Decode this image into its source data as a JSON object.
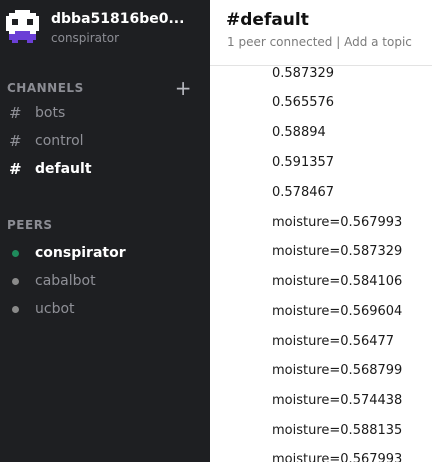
{
  "profile": {
    "name": "dbba51816be0...",
    "subtitle": "conspirator"
  },
  "channels": {
    "heading": "CHANNELS",
    "add_label": "+",
    "items": [
      {
        "label": "bots",
        "active": false
      },
      {
        "label": "control",
        "active": false
      },
      {
        "label": "default",
        "active": true
      }
    ]
  },
  "peers": {
    "heading": "PEERS",
    "items": [
      {
        "label": "conspirator",
        "online": true
      },
      {
        "label": "cabalbot",
        "online": false
      },
      {
        "label": "ucbot",
        "online": false
      }
    ]
  },
  "header": {
    "title": "#default",
    "peers_connected": "1 peer connected",
    "separator": " | ",
    "topic_link": "Add a topic"
  },
  "messages": [
    "0.587329",
    "0.565576",
    "0.58894",
    "0.591357",
    "0.578467",
    "moisture=0.567993",
    "moisture=0.587329",
    "moisture=0.584106",
    "moisture=0.569604",
    "moisture=0.56477",
    "moisture=0.568799",
    "moisture=0.574438",
    "moisture=0.588135",
    "moisture=0.567993"
  ],
  "colors": {
    "sidebar_bg": "#1e1f22",
    "online": "#1f8b5c",
    "offline": "#8a8a8a",
    "avatar_fg": "#ffffff",
    "avatar_accent": "#6b3fd6"
  },
  "icons": {
    "avatar": "pixel-avatar-icon",
    "channel": "hash-icon",
    "add": "plus-icon",
    "status": "status-dot-icon"
  }
}
